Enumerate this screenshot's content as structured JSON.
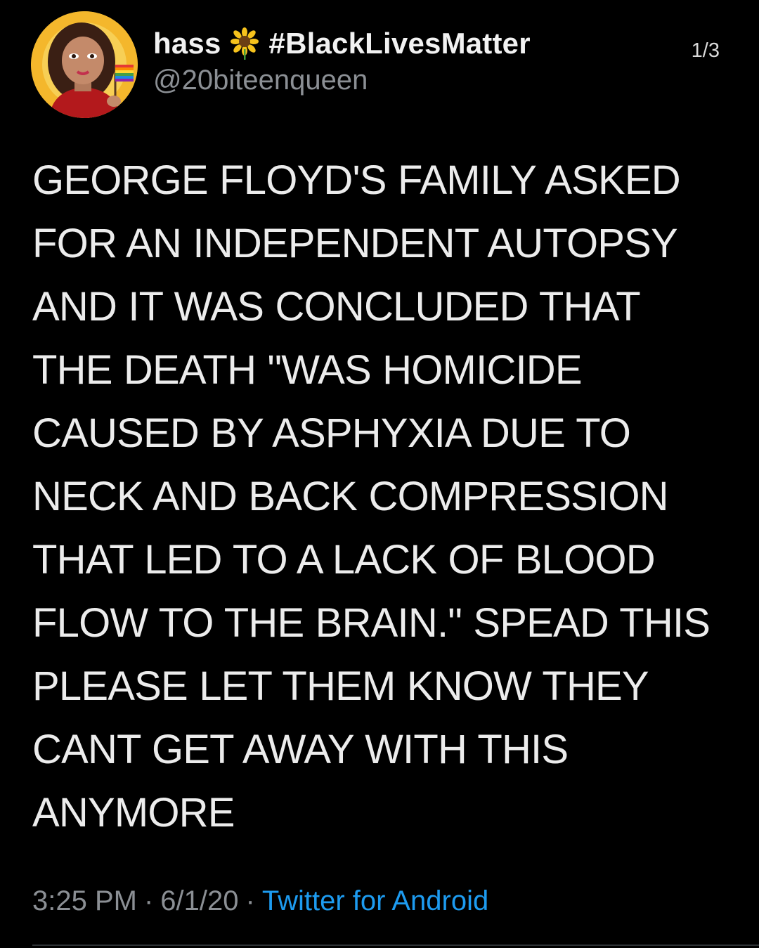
{
  "colors": {
    "background": "#000000",
    "text": "#ececec",
    "muted": "#8b8f94",
    "link": "#1d9bf0"
  },
  "user": {
    "display_name": "hass",
    "emoji": "sunflower-icon",
    "hashtag": "#BlackLivesMatter",
    "handle": "@20biteenqueen"
  },
  "thread_counter": "1/3",
  "tweet_lines": [
    "GEORGE FLOYD'S FAMILY ASKED",
    "FOR AN INDEPENDENT AUTOPSY",
    "AND IT WAS CONCLUDED THAT",
    "THE DEATH \"WAS HOMICIDE",
    "CAUSED BY ASPHYXIA DUE TO",
    "NECK AND BACK COMPRESSION",
    "THAT LED TO A LACK OF BLOOD",
    "FLOW TO THE BRAIN.\" SPEAD THIS",
    "PLEASE LET THEM KNOW THEY",
    "CANT GET AWAY WITH THIS",
    "ANYMORE"
  ],
  "meta": {
    "time": "3:25 PM",
    "separator": "·",
    "date": "6/1/20",
    "source": "Twitter for Android"
  }
}
